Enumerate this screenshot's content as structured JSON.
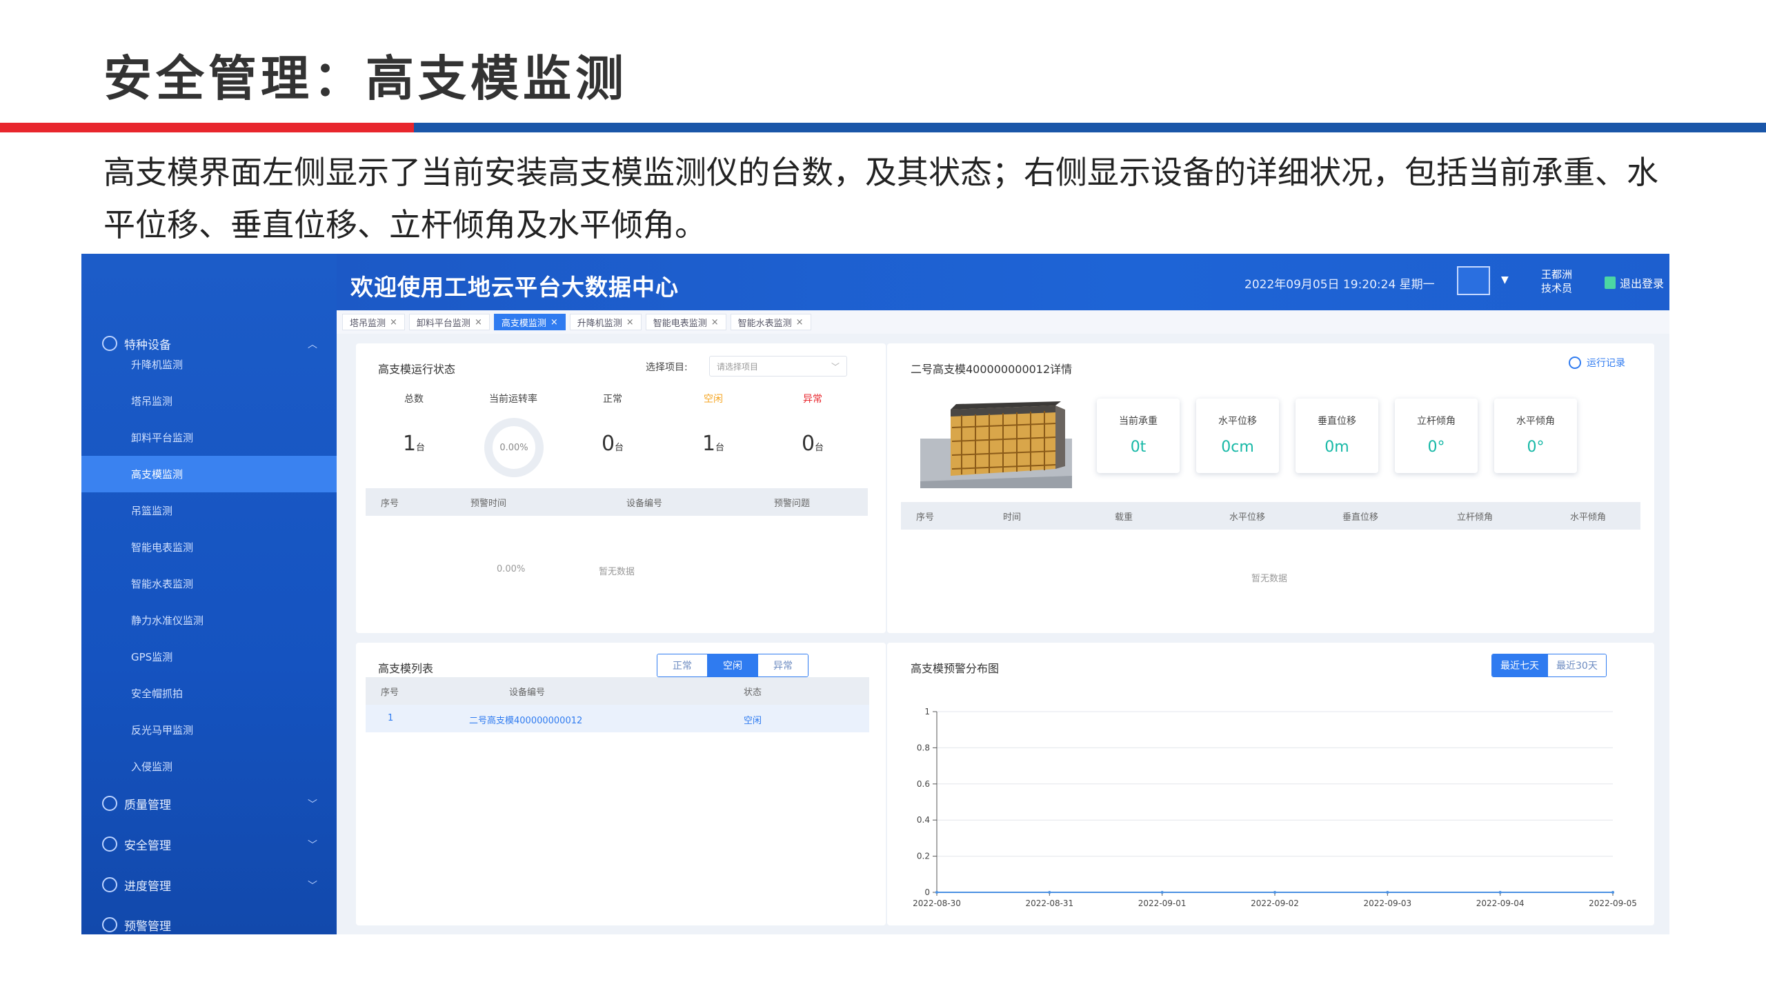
{
  "slide": {
    "title": "安全管理：高支模监测",
    "description": "高支模界面左侧显示了当前安装高支模监测仪的台数，及其状态；右侧显示设备的详细状况，包括当前承重、水平位移、垂直位移、立杆倾角及水平倾角。"
  },
  "colors": {
    "brand_red": "#e8262d",
    "brand_blue": "#1a56a8",
    "accent": "#2f7bf0",
    "teal": "#16b8a6"
  },
  "sidebar": {
    "groups": [
      {
        "label": "特种设备",
        "icon": "gear-icon"
      },
      {
        "label": "质量管理",
        "icon": "shield-icon"
      },
      {
        "label": "安全管理",
        "icon": "shield-check-icon"
      },
      {
        "label": "进度管理",
        "icon": "progress-icon"
      },
      {
        "label": "预警管理",
        "icon": "alert-gear-icon"
      }
    ],
    "items": [
      {
        "label": "升降机监测"
      },
      {
        "label": "塔吊监测"
      },
      {
        "label": "卸料平台监测"
      },
      {
        "label": "高支模监测",
        "active": true
      },
      {
        "label": "吊篮监测"
      },
      {
        "label": "智能电表监测"
      },
      {
        "label": "智能水表监测"
      },
      {
        "label": "静力水准仪监测"
      },
      {
        "label": "GPS监测"
      },
      {
        "label": "安全帽抓拍"
      },
      {
        "label": "反光马甲监测"
      },
      {
        "label": "入侵监测"
      }
    ]
  },
  "topbar": {
    "title": "欢迎使用工地云平台大数据中心",
    "datetime": "2022年09月05日 19:20:24 星期一",
    "user_name": "王都洲",
    "user_role": "技术员",
    "logout": "退出登录"
  },
  "tabs": [
    {
      "label": "塔吊监测",
      "active": false
    },
    {
      "label": "卸料平台监测",
      "active": false
    },
    {
      "label": "高支模监测",
      "active": true
    },
    {
      "label": "升降机监测",
      "active": false
    },
    {
      "label": "智能电表监测",
      "active": false
    },
    {
      "label": "智能水表监测",
      "active": false
    }
  ],
  "status_panel": {
    "title": "高支模运行状态",
    "select_label": "选择项目:",
    "select_placeholder": "请选择项目",
    "stats": [
      {
        "label": "总数",
        "value": "1",
        "unit": "台",
        "color": "#444444"
      },
      {
        "label": "当前运转率",
        "value": "0.00%",
        "color": "#444444"
      },
      {
        "label": "正常",
        "value": "0",
        "unit": "台",
        "color": "#444444"
      },
      {
        "label": "空闲",
        "value": "1",
        "unit": "台",
        "color": "#f5a623"
      },
      {
        "label": "异常",
        "value": "0",
        "unit": "台",
        "color": "#e8262d"
      }
    ],
    "columns": [
      "序号",
      "预警时间",
      "设备编号",
      "预警问题"
    ],
    "empty_value": "0.00%",
    "empty_text": "暂无数据"
  },
  "detail_panel": {
    "title": "二号高支模400000000012详情",
    "op_log": "运行记录",
    "cards": [
      {
        "label": "当前承重",
        "value": "0t"
      },
      {
        "label": "水平位移",
        "value": "0cm"
      },
      {
        "label": "垂直位移",
        "value": "0m"
      },
      {
        "label": "立杆倾角",
        "value": "0°"
      },
      {
        "label": "水平倾角",
        "value": "0°"
      }
    ],
    "columns": [
      "序号",
      "时间",
      "载重",
      "水平位移",
      "垂直位移",
      "立杆倾角",
      "水平倾角"
    ],
    "empty_text": "暂无数据"
  },
  "list_panel": {
    "title": "高支模列表",
    "filters": [
      {
        "label": "正常",
        "active": false
      },
      {
        "label": "空闲",
        "active": true
      },
      {
        "label": "异常",
        "active": false
      }
    ],
    "columns": [
      "序号",
      "设备编号",
      "状态"
    ],
    "rows": [
      {
        "index": "1",
        "device": "二号高支模400000000012",
        "status": "空闲"
      }
    ]
  },
  "chart_panel": {
    "title": "高支模预警分布图",
    "range_buttons": [
      {
        "label": "最近七天",
        "active": true
      },
      {
        "label": "最近30天",
        "active": false
      }
    ]
  },
  "chart_data": {
    "type": "line",
    "title": "",
    "x": [
      "2022-08-30",
      "2022-08-31",
      "2022-09-01",
      "2022-09-02",
      "2022-09-03",
      "2022-09-04",
      "2022-09-05"
    ],
    "series": [
      {
        "values": [
          0,
          0,
          0,
          0,
          0,
          0,
          0
        ]
      }
    ],
    "ylim": [
      0,
      1
    ],
    "yticks": [
      "0",
      "0.2",
      "0.4",
      "0.6",
      "0.8",
      "1"
    ],
    "grid": true
  }
}
